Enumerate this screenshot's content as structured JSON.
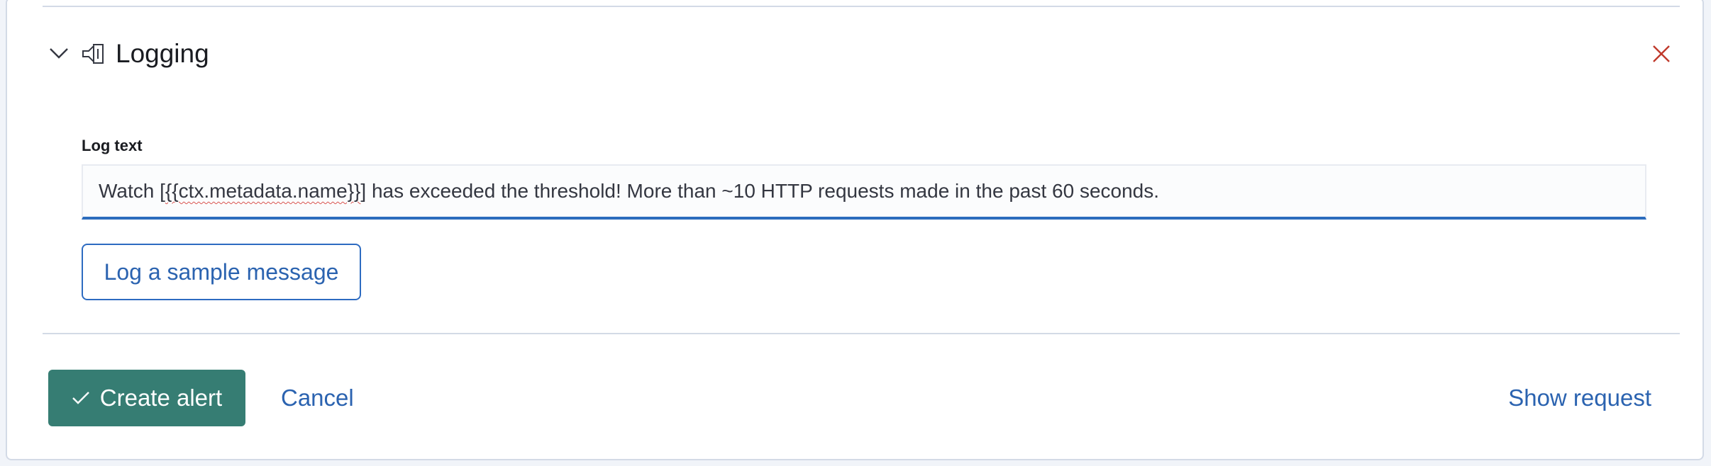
{
  "section": {
    "title": "Logging",
    "chevron_icon": "chevron-down-icon",
    "logging_icon": "logging-icon",
    "close_icon": "close-icon"
  },
  "log_text_field": {
    "label": "Log text",
    "value_prefix": "Watch [",
    "value_variable": "{{ctx.metadata.name}}",
    "value_suffix": "] has exceeded the threshold! More than ~10 HTTP requests made in the past 60 seconds."
  },
  "sample_button": {
    "label": "Log a sample message"
  },
  "footer": {
    "create_label": "Create alert",
    "cancel_label": "Cancel",
    "show_request_label": "Show request"
  },
  "colors": {
    "primary": "#367d73",
    "link": "#2b63b0",
    "close": "#c0392b",
    "input_focus": "#2c6cbd"
  }
}
